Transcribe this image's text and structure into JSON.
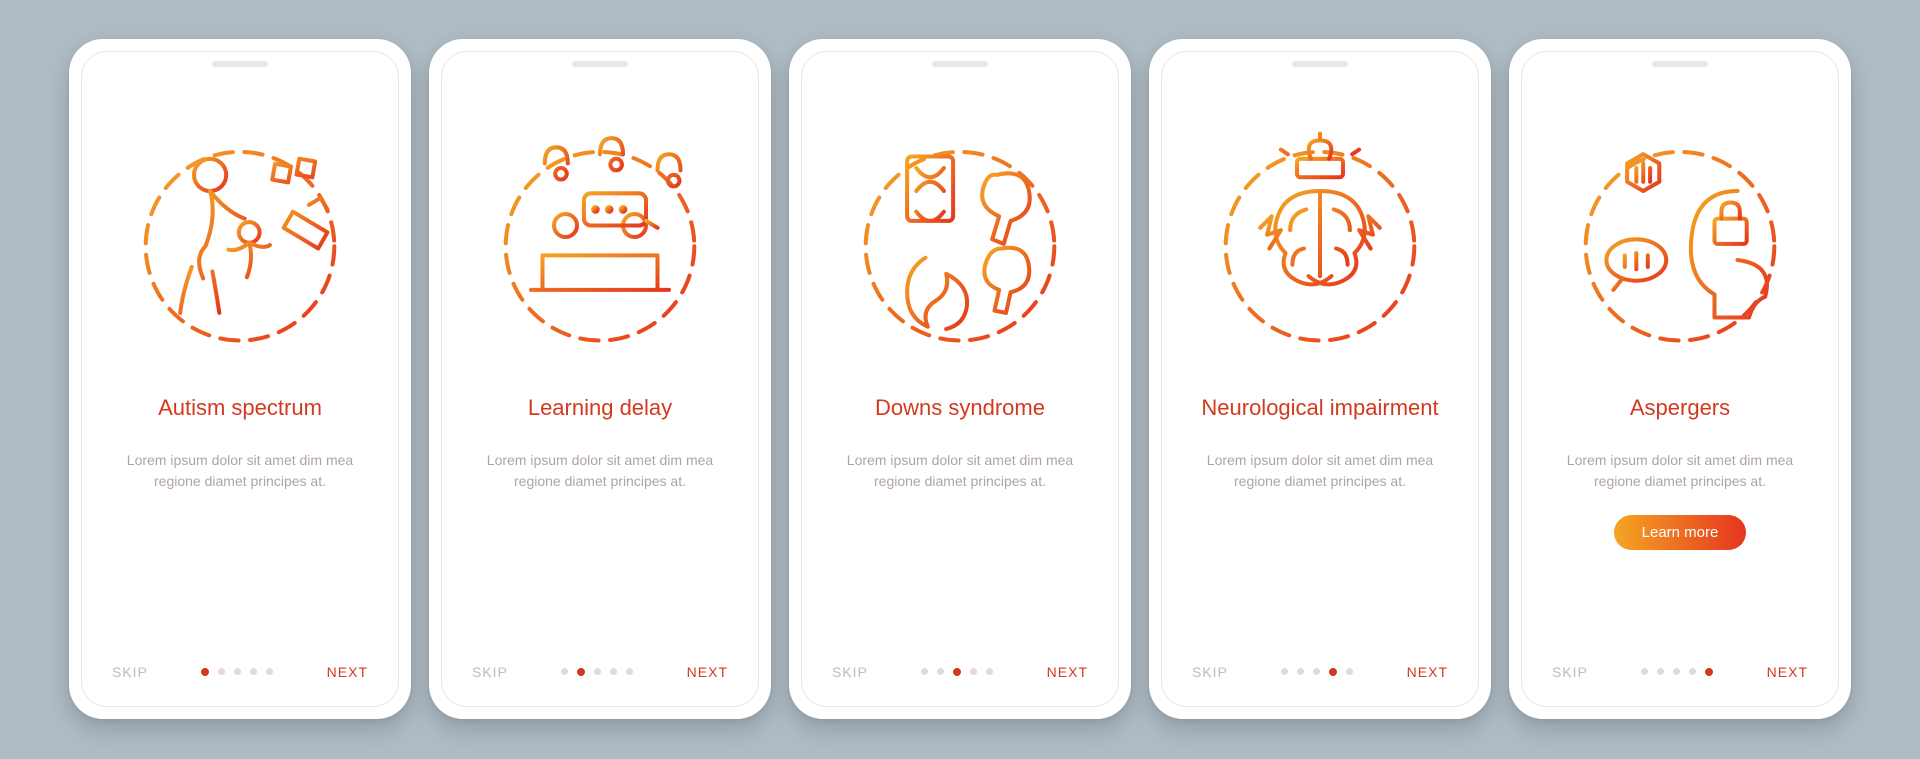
{
  "colors": {
    "accent": "#d23a1f",
    "gradient_start": "#f5a623",
    "gradient_end": "#e5351f",
    "background": "#afbcc5",
    "muted": "#b0a49e",
    "dot_inactive": "#e6d8d2"
  },
  "common": {
    "skip_label": "SKIP",
    "next_label": "NEXT",
    "body_text": "Lorem ipsum dolor sit amet dim mea regione diamet principes at.",
    "total_dots": 5
  },
  "screens": [
    {
      "title": "Autism spectrum",
      "icon": "autism-spectrum-illustration",
      "active_dot": 0,
      "has_cta": false
    },
    {
      "title": "Learning delay",
      "icon": "learning-delay-illustration",
      "active_dot": 1,
      "has_cta": false
    },
    {
      "title": "Downs syndrome",
      "icon": "downs-syndrome-illustration",
      "active_dot": 2,
      "has_cta": false
    },
    {
      "title": "Neurological impairment",
      "icon": "neurological-impairment-illustration",
      "active_dot": 3,
      "has_cta": false
    },
    {
      "title": "Aspergers",
      "icon": "aspergers-illustration",
      "active_dot": 4,
      "has_cta": true,
      "cta_label": "Learn more"
    }
  ]
}
